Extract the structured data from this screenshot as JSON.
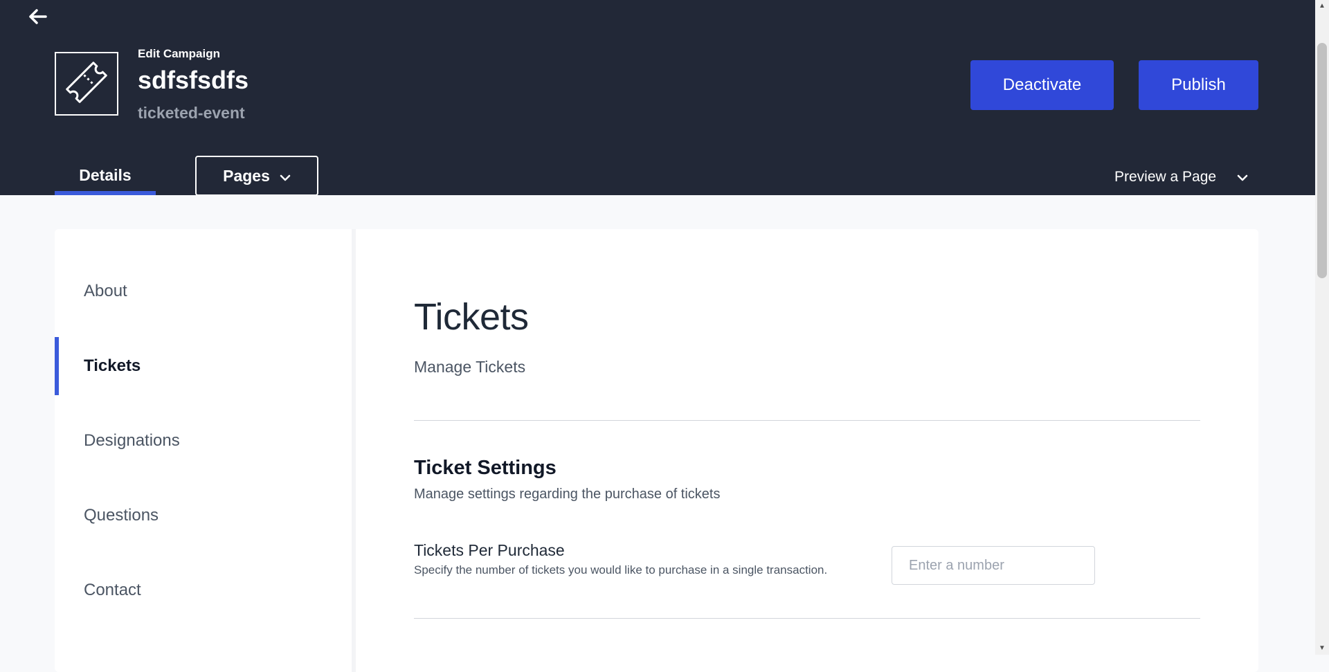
{
  "header": {
    "back_icon": "arrow-left-icon",
    "logo_icon": "ticket-icon",
    "edit_label": "Edit Campaign",
    "campaign_name": "sdfsfsdfs",
    "campaign_type": "ticketed-event",
    "deactivate_label": "Deactivate",
    "publish_label": "Publish",
    "accent_color": "#3048d9",
    "background_color": "#222837"
  },
  "tabs": {
    "details_label": "Details",
    "pages_label": "Pages",
    "preview_label": "Preview a Page"
  },
  "sidebar": {
    "items": [
      {
        "label": "About",
        "active": false
      },
      {
        "label": "Tickets",
        "active": true
      },
      {
        "label": "Designations",
        "active": false
      },
      {
        "label": "Questions",
        "active": false
      },
      {
        "label": "Contact",
        "active": false
      }
    ]
  },
  "main": {
    "title": "Tickets",
    "subtitle": "Manage Tickets",
    "section": {
      "title": "Ticket Settings",
      "description": "Manage settings regarding the purchase of tickets"
    },
    "field": {
      "label": "Tickets Per Purchase",
      "help": "Specify the number of tickets you would like to purchase in a single transaction.",
      "value": "",
      "placeholder": "Enter a number"
    }
  }
}
